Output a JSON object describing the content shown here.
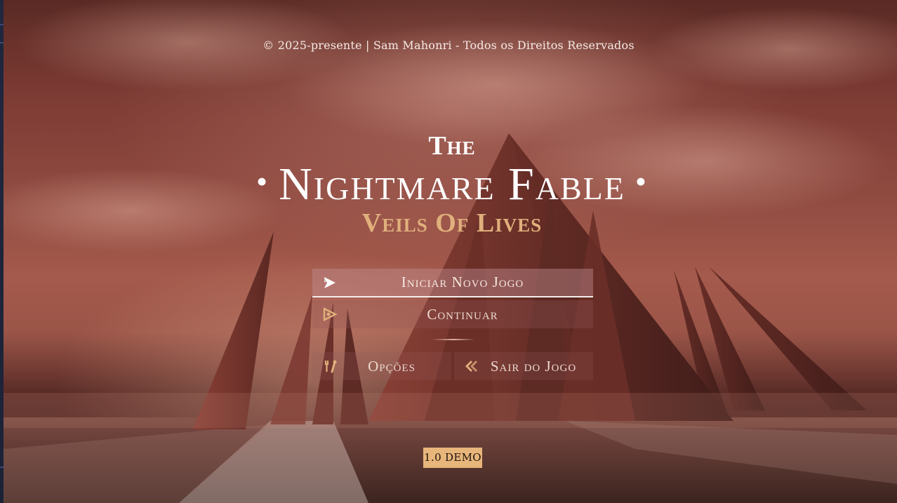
{
  "copyright": "© 2025-presente | Sam Mahonri - Todos os Direitos Reservados",
  "title": {
    "the": "The",
    "main": "Nightmare Fable",
    "bullet_left": "•",
    "bullet_right": "•",
    "subtitle": "Veils Of Lives"
  },
  "menu": {
    "new_game": {
      "label": "Iniciar Novo Jogo",
      "icon": "play-icon",
      "selected": true
    },
    "continue": {
      "label": "Continuar",
      "icon": "continue-icon"
    },
    "options": {
      "label": "Opções",
      "icon": "tools-icon"
    },
    "quit": {
      "label": "Sair do Jogo",
      "icon": "double-chevron-left-icon"
    }
  },
  "version": "1.0 DEMO",
  "colors": {
    "accent_gold": "#e0b07c",
    "version_badge": "#e8b57a",
    "text_light": "#f6e6de"
  }
}
